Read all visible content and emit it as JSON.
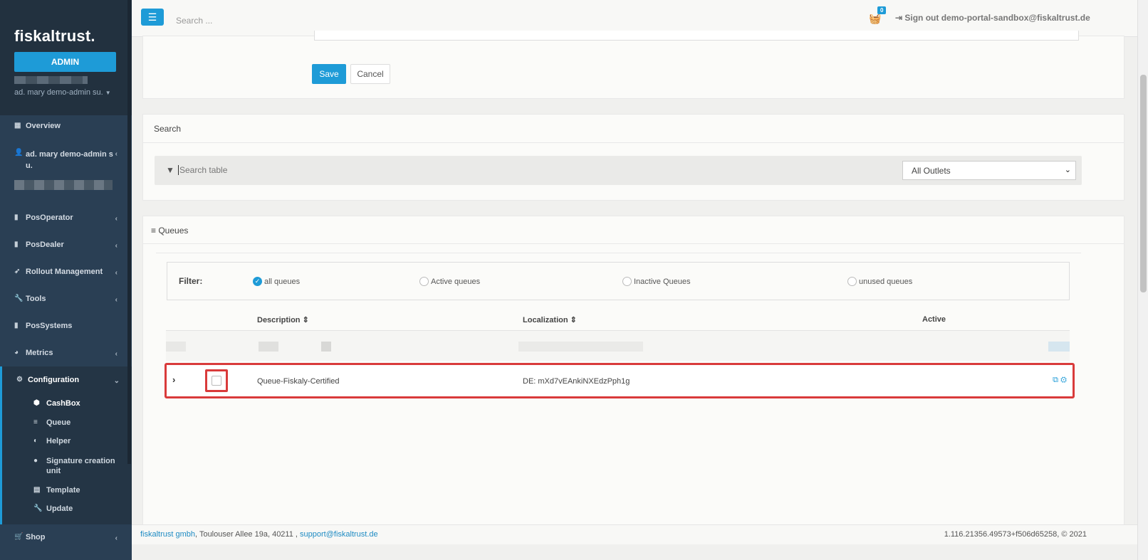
{
  "sidebar": {
    "logo": "fiskaltrust.",
    "admin_label": "ADMIN",
    "user": "ad. mary demo-admin su.",
    "items": [
      {
        "label": "Overview"
      },
      {
        "label": "ad. mary demo-admin s",
        "label2": "u."
      },
      {
        "label": "PosOperator"
      },
      {
        "label": "PosDealer"
      },
      {
        "label": "Rollout Management"
      },
      {
        "label": "Tools"
      },
      {
        "label": "PosSystems"
      },
      {
        "label": "Metrics"
      },
      {
        "label": "Configuration"
      },
      {
        "label": "Shop"
      }
    ],
    "config_sub": [
      {
        "label": "CashBox"
      },
      {
        "label": "Queue"
      },
      {
        "label": "Helper"
      },
      {
        "label": "Signature creation",
        "label2": "unit"
      },
      {
        "label": "Template"
      },
      {
        "label": "Update"
      }
    ]
  },
  "topbar": {
    "search_placeholder": "Search ...",
    "cart_count": "0",
    "signout": "Sign out demo-portal-sandbox@fiskaltrust.de"
  },
  "form": {
    "save_label": "Save",
    "cancel_label": "Cancel"
  },
  "search_panel": {
    "title": "Search",
    "input_placeholder": "Search table",
    "outlet_selected": "All Outlets"
  },
  "queues_panel": {
    "title": "Queues",
    "filter_label": "Filter:",
    "filters": [
      "all queues",
      "Active queues",
      "Inactive Queues",
      "unused queues"
    ],
    "columns": [
      "Description",
      "Localization",
      "Active"
    ],
    "row": {
      "description": "Queue-Fiskaly-Certified",
      "localization": "DE: mXd7vEAnkiNXEdzPph1g"
    }
  },
  "footer": {
    "company": "fiskaltrust gmbh",
    "address": ", Toulouser Allee 19a, 40211 ,",
    "email": "support@fiskaltrust.de",
    "version": "1.116.21356.49573+f506d65258, © 2021"
  },
  "colors": {
    "accent": "#1e9bd7",
    "sidebar": "#2a3f54",
    "highlight": "#d93b3b"
  }
}
